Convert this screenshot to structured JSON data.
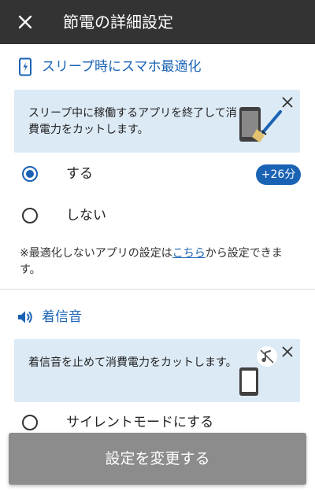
{
  "app_bar": {
    "title": "節電の詳細設定",
    "close_icon": "close-icon"
  },
  "sections": {
    "sleep": {
      "icon": "phone-sleep-icon",
      "title": "スリープ時にスマホ最適化",
      "card": {
        "text": "スリープ中に稼働するアプリを終了して消費電力をカットします。",
        "illustration": "phone-broom-illustration",
        "close_icon": "close-icon"
      },
      "options": [
        {
          "label": "する",
          "selected": true,
          "badge": "+26分"
        },
        {
          "label": "しない",
          "selected": false
        }
      ],
      "note": {
        "prefix": "※最適化しないアプリの設定は",
        "link": "こちら",
        "suffix": "から設定できます。"
      }
    },
    "ringtone": {
      "icon": "speaker-icon",
      "title": "着信音",
      "card": {
        "text": "着信音を止めて消費電力をカットします。",
        "illustration": "phone-muted-note-illustration",
        "close_icon": "close-icon"
      },
      "options": [
        {
          "label": "サイレントモードにする",
          "selected": false
        }
      ]
    }
  },
  "footer": {
    "button_label": "設定を変更する"
  },
  "colors": {
    "app_bar": "#333333",
    "accent": "#1a63b4",
    "card_background": "#dceaf6",
    "button_disabled": "#8c8c8c"
  }
}
